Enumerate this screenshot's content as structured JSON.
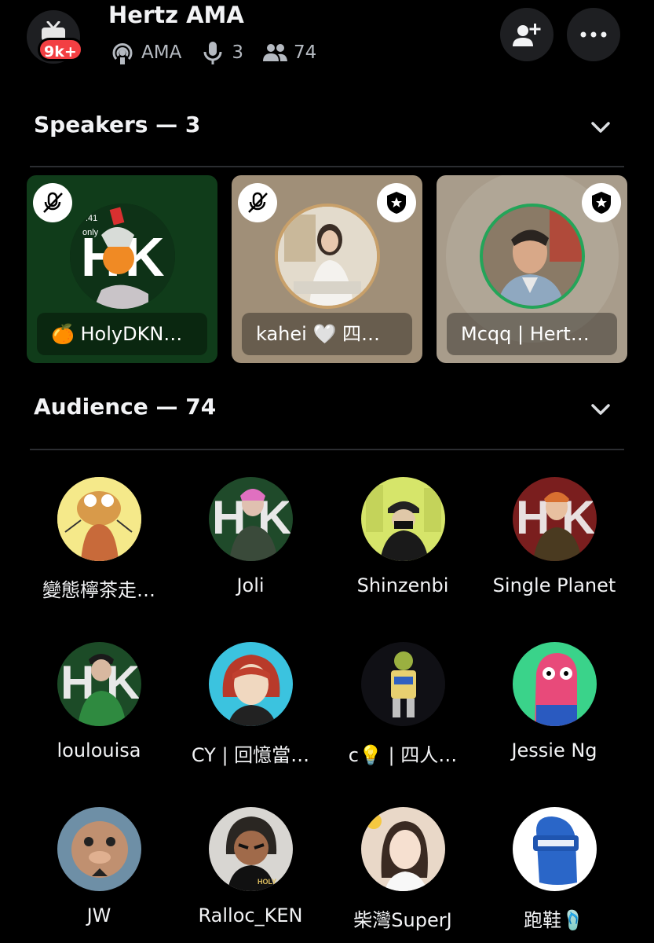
{
  "header": {
    "badge": "9k+",
    "title": "Hertz AMA",
    "stage_type": "AMA",
    "speaker_count": "3",
    "listener_count": "74"
  },
  "speakers": {
    "heading": "Speakers — 3",
    "cards": [
      {
        "name": "🍊 HolyDKN…",
        "bg": "#103c1a",
        "muted": true,
        "moderator": false
      },
      {
        "name": "kahei 🤍 四…",
        "bg": "#a08f78",
        "muted": true,
        "moderator": true
      },
      {
        "name": "Mcqq | Hert…",
        "bg": "#a89c8b",
        "muted": false,
        "moderator": true
      }
    ]
  },
  "audience": {
    "heading": "Audience — 74",
    "members": [
      {
        "name": "變態檸茶走…",
        "color": "#f0e070"
      },
      {
        "name": "Joli",
        "color": "#1f4a2a"
      },
      {
        "name": "Shinzenbi",
        "color": "#d6e56a"
      },
      {
        "name": "Single Planet",
        "color": "#7a1e1e"
      },
      {
        "name": "loulouisa",
        "color": "#1c4b27"
      },
      {
        "name": "CY | 回憶當…",
        "color": "#3bc3df"
      },
      {
        "name": "c💡 | 四人…",
        "color": "#101015"
      },
      {
        "name": "Jessie Ng",
        "color": "#3ad38a"
      },
      {
        "name": "JW",
        "color": "#6e8fa6"
      },
      {
        "name": "Ralloc_KEN",
        "color": "#d8d6d2"
      },
      {
        "name": "柴灣SuperJ",
        "color": "#e9d8c8"
      },
      {
        "name": "跑鞋🩴",
        "color": "#ffffff"
      }
    ]
  },
  "colors": {
    "background": "#000000",
    "surface": "#1e1f22",
    "badge_red": "#f23f43",
    "speaking_ring": "#23a559"
  }
}
